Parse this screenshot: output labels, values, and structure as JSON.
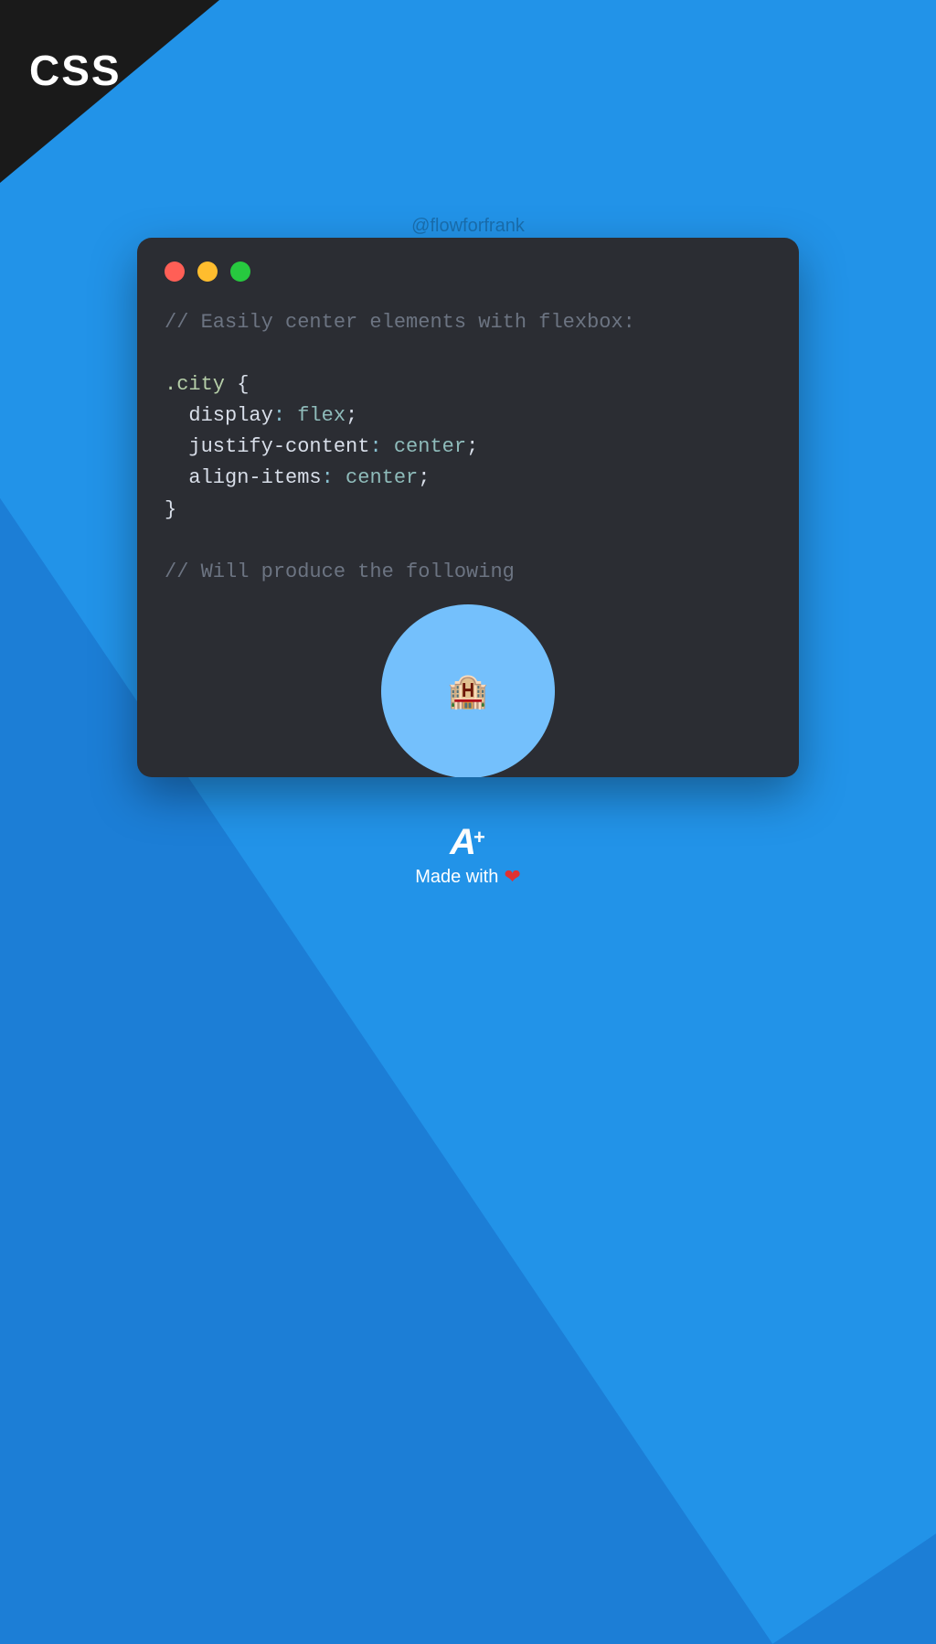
{
  "badge": {
    "label": "CSS"
  },
  "watermark": "@flowforfrank",
  "code": {
    "comment1": "// Easily center elements with flexbox:",
    "selector": ".city",
    "brace_open": " {",
    "prop1": "display",
    "val1": "flex",
    "prop2": "justify-content",
    "val2": "center",
    "prop3": "align-items",
    "val3": "center",
    "brace_close": "}",
    "comment2": "// Will produce the following",
    "colon": ": ",
    "semicolon": ";"
  },
  "demo": {
    "emoji": "🏨"
  },
  "footer": {
    "logo_main": "A",
    "logo_plus": "+",
    "made_with": "Made with",
    "heart": "❤"
  }
}
